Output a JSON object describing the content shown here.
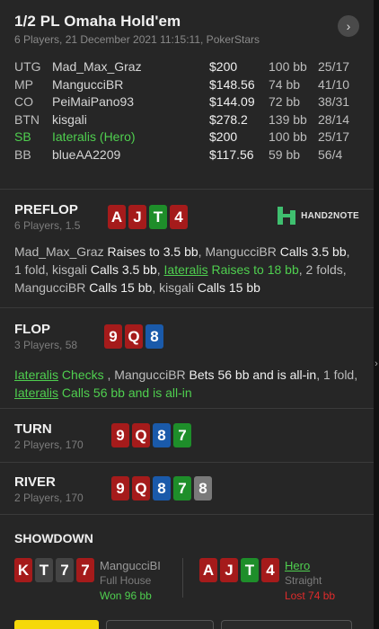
{
  "header": {
    "title": "1/2 PL Omaha Hold'em",
    "subtitle": "6 Players, 21 December 2021 11:15:11, PokerStars",
    "next_icon": "chevron-right"
  },
  "players": [
    {
      "pos": "UTG",
      "name": "Mad_Max_Graz",
      "stack": "$200",
      "bb": "100 bb",
      "cards": "25/17",
      "hero": false
    },
    {
      "pos": "MP",
      "name": "MangucciBR",
      "stack": "$148.56",
      "bb": "74 bb",
      "cards": "41/10",
      "hero": false
    },
    {
      "pos": "CO",
      "name": "PeiMaiPano93",
      "stack": "$144.09",
      "bb": "72 bb",
      "cards": "38/31",
      "hero": false
    },
    {
      "pos": "BTN",
      "name": "kisgali",
      "stack": "$278.2",
      "bb": "139 bb",
      "cards": "28/14",
      "hero": false
    },
    {
      "pos": "SB",
      "name": "Iateralis (Hero)",
      "stack": "$200",
      "bb": "100 bb",
      "cards": "25/17",
      "hero": true
    },
    {
      "pos": "BB",
      "name": "blueAA2209",
      "stack": "$117.56",
      "bb": "59 bb",
      "cards": "56/4",
      "hero": false
    }
  ],
  "colors": {
    "red": "#a51b1b",
    "green": "#1e8e2a",
    "blue": "#1a5aaa",
    "black": "#444444",
    "grey": "#7a7a7a",
    "hero": "#4fcf4f",
    "lost": "#e02b2b",
    "accent": "#f5d90a"
  },
  "preflop": {
    "name": "PREFLOP",
    "sub": "6 Players, 1.5",
    "cards": [
      {
        "r": "A",
        "c": "r"
      },
      {
        "r": "J",
        "c": "r"
      },
      {
        "r": "T",
        "c": "g"
      },
      {
        "r": "4",
        "c": "r"
      }
    ],
    "logo_text": "HAND2NOTE",
    "segments": [
      {
        "t": "Mad_Max_Graz ",
        "k": "pl"
      },
      {
        "t": "Raises to 3.5 bb",
        "k": "act"
      },
      {
        "t": ", ",
        "k": "pl"
      },
      {
        "t": "MangucciBR ",
        "k": "pl"
      },
      {
        "t": "Calls 3.5 bb",
        "k": "act"
      },
      {
        "t": ", 1 fold, ",
        "k": "pl"
      },
      {
        "t": "kisgali ",
        "k": "pl"
      },
      {
        "t": "Calls 3.5 bb",
        "k": "act"
      },
      {
        "t": ", ",
        "k": "pl"
      },
      {
        "t": "Iateralis",
        "k": "heroname"
      },
      {
        "t": " Raises to 18 bb",
        "k": "heroact"
      },
      {
        "t": ", 2 folds, ",
        "k": "pl"
      },
      {
        "t": "MangucciBR ",
        "k": "pl"
      },
      {
        "t": "Calls 15 bb",
        "k": "act"
      },
      {
        "t": ", ",
        "k": "pl"
      },
      {
        "t": "kisgali ",
        "k": "pl"
      },
      {
        "t": "Calls 15 bb",
        "k": "act"
      }
    ]
  },
  "flop": {
    "name": "FLOP",
    "sub": "3 Players, 58",
    "cards": [
      {
        "r": "9",
        "c": "r"
      },
      {
        "r": "Q",
        "c": "r"
      },
      {
        "r": "8",
        "c": "b"
      }
    ],
    "segments": [
      {
        "t": "Iateralis",
        "k": "heroname"
      },
      {
        "t": " Checks",
        "k": "heroact"
      },
      {
        "t": " , ",
        "k": "pl"
      },
      {
        "t": "MangucciBR ",
        "k": "pl"
      },
      {
        "t": "Bets 56 bb and is all-in",
        "k": "act"
      },
      {
        "t": ", 1 fold, ",
        "k": "pl"
      },
      {
        "t": "Iateralis",
        "k": "heroname"
      },
      {
        "t": " Calls 56 bb and is all-in",
        "k": "heroact"
      }
    ]
  },
  "turn": {
    "name": "TURN",
    "sub": "2 Players, 170",
    "cards": [
      {
        "r": "9",
        "c": "r"
      },
      {
        "r": "Q",
        "c": "r"
      },
      {
        "r": "8",
        "c": "b"
      },
      {
        "r": "7",
        "c": "g"
      }
    ]
  },
  "river": {
    "name": "RIVER",
    "sub": "2 Players, 170",
    "cards": [
      {
        "r": "9",
        "c": "r"
      },
      {
        "r": "Q",
        "c": "r"
      },
      {
        "r": "8",
        "c": "b"
      },
      {
        "r": "7",
        "c": "g"
      },
      {
        "r": "8",
        "c": "y"
      }
    ]
  },
  "showdown": {
    "title": "SHOWDOWN",
    "villain": {
      "cards": [
        {
          "r": "K",
          "c": "r"
        },
        {
          "r": "T",
          "c": "k"
        },
        {
          "r": "7",
          "c": "k"
        },
        {
          "r": "7",
          "c": "r"
        }
      ],
      "name": "MangucciBI",
      "rank": "Full House",
      "result": "Won 96 bb"
    },
    "hero": {
      "cards": [
        {
          "r": "A",
          "c": "r"
        },
        {
          "r": "J",
          "c": "r"
        },
        {
          "r": "T",
          "c": "g"
        },
        {
          "r": "4",
          "c": "r"
        }
      ],
      "name": "Hero",
      "rank": "Straight",
      "result": "Lost 74 bb"
    }
  }
}
